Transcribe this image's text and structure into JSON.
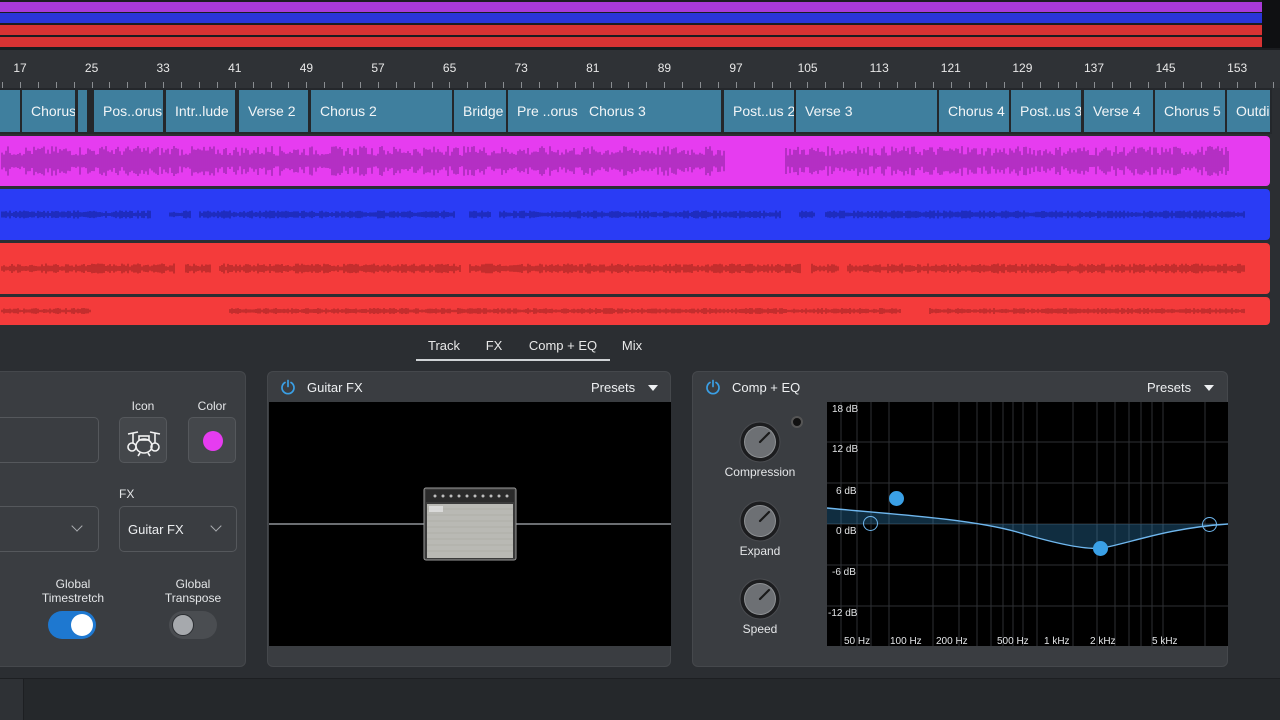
{
  "colors": {
    "track_magenta": "#e63cf0",
    "track_blue": "#2a3cf5",
    "track_red": "#f43b3b",
    "arranger_section": "#3f7f9e",
    "accent_blue": "#1e78d0",
    "eq_accent": "#3aa0e6"
  },
  "ruler": {
    "bars": [
      "17",
      "25",
      "33",
      "41",
      "49",
      "57",
      "65",
      "73",
      "81",
      "89",
      "97",
      "105",
      "113",
      "121",
      "129",
      "137",
      "145",
      "153"
    ]
  },
  "arranger": {
    "sections": [
      "",
      "Chorus",
      "",
      "Pos..orus",
      "Intr..lude",
      "Verse 2",
      "Chorus 2",
      "Bridge",
      "Pre ..orus",
      "Chorus 3",
      "Post..us 2",
      "Verse 3",
      "Chorus 4",
      "Post..us 3",
      "Verse 4",
      "Chorus 5",
      "Outdi"
    ]
  },
  "tabs": [
    "Track",
    "FX",
    "Comp + EQ",
    "Mix"
  ],
  "track_panel": {
    "icon_label": "Icon",
    "color_label": "Color",
    "fx_label": "FX",
    "fx_value": "Guitar FX",
    "timestretch_label": "Global\nTimestretch",
    "transpose_label": "Global\nTranspose",
    "timestretch_on": true,
    "transpose_on": false,
    "track_icon": "drum-kit-icon",
    "track_color": "#e63cf0"
  },
  "guitar_fx": {
    "title": "Guitar FX",
    "presets_label": "Presets",
    "amp_icon": "guitar-amp-icon"
  },
  "comp_eq": {
    "title": "Comp + EQ",
    "presets_label": "Presets",
    "knobs": [
      "Compression",
      "Expand",
      "Speed"
    ],
    "eq_db_labels": [
      "18 dB",
      "12 dB",
      "6 dB",
      "0 dB",
      "-6 dB",
      "-12 dB"
    ],
    "eq_freq_labels": [
      "50 Hz",
      "100 Hz",
      "200 Hz",
      "500 Hz",
      "1 kHz",
      "2 kHz",
      "5 kHz"
    ]
  }
}
